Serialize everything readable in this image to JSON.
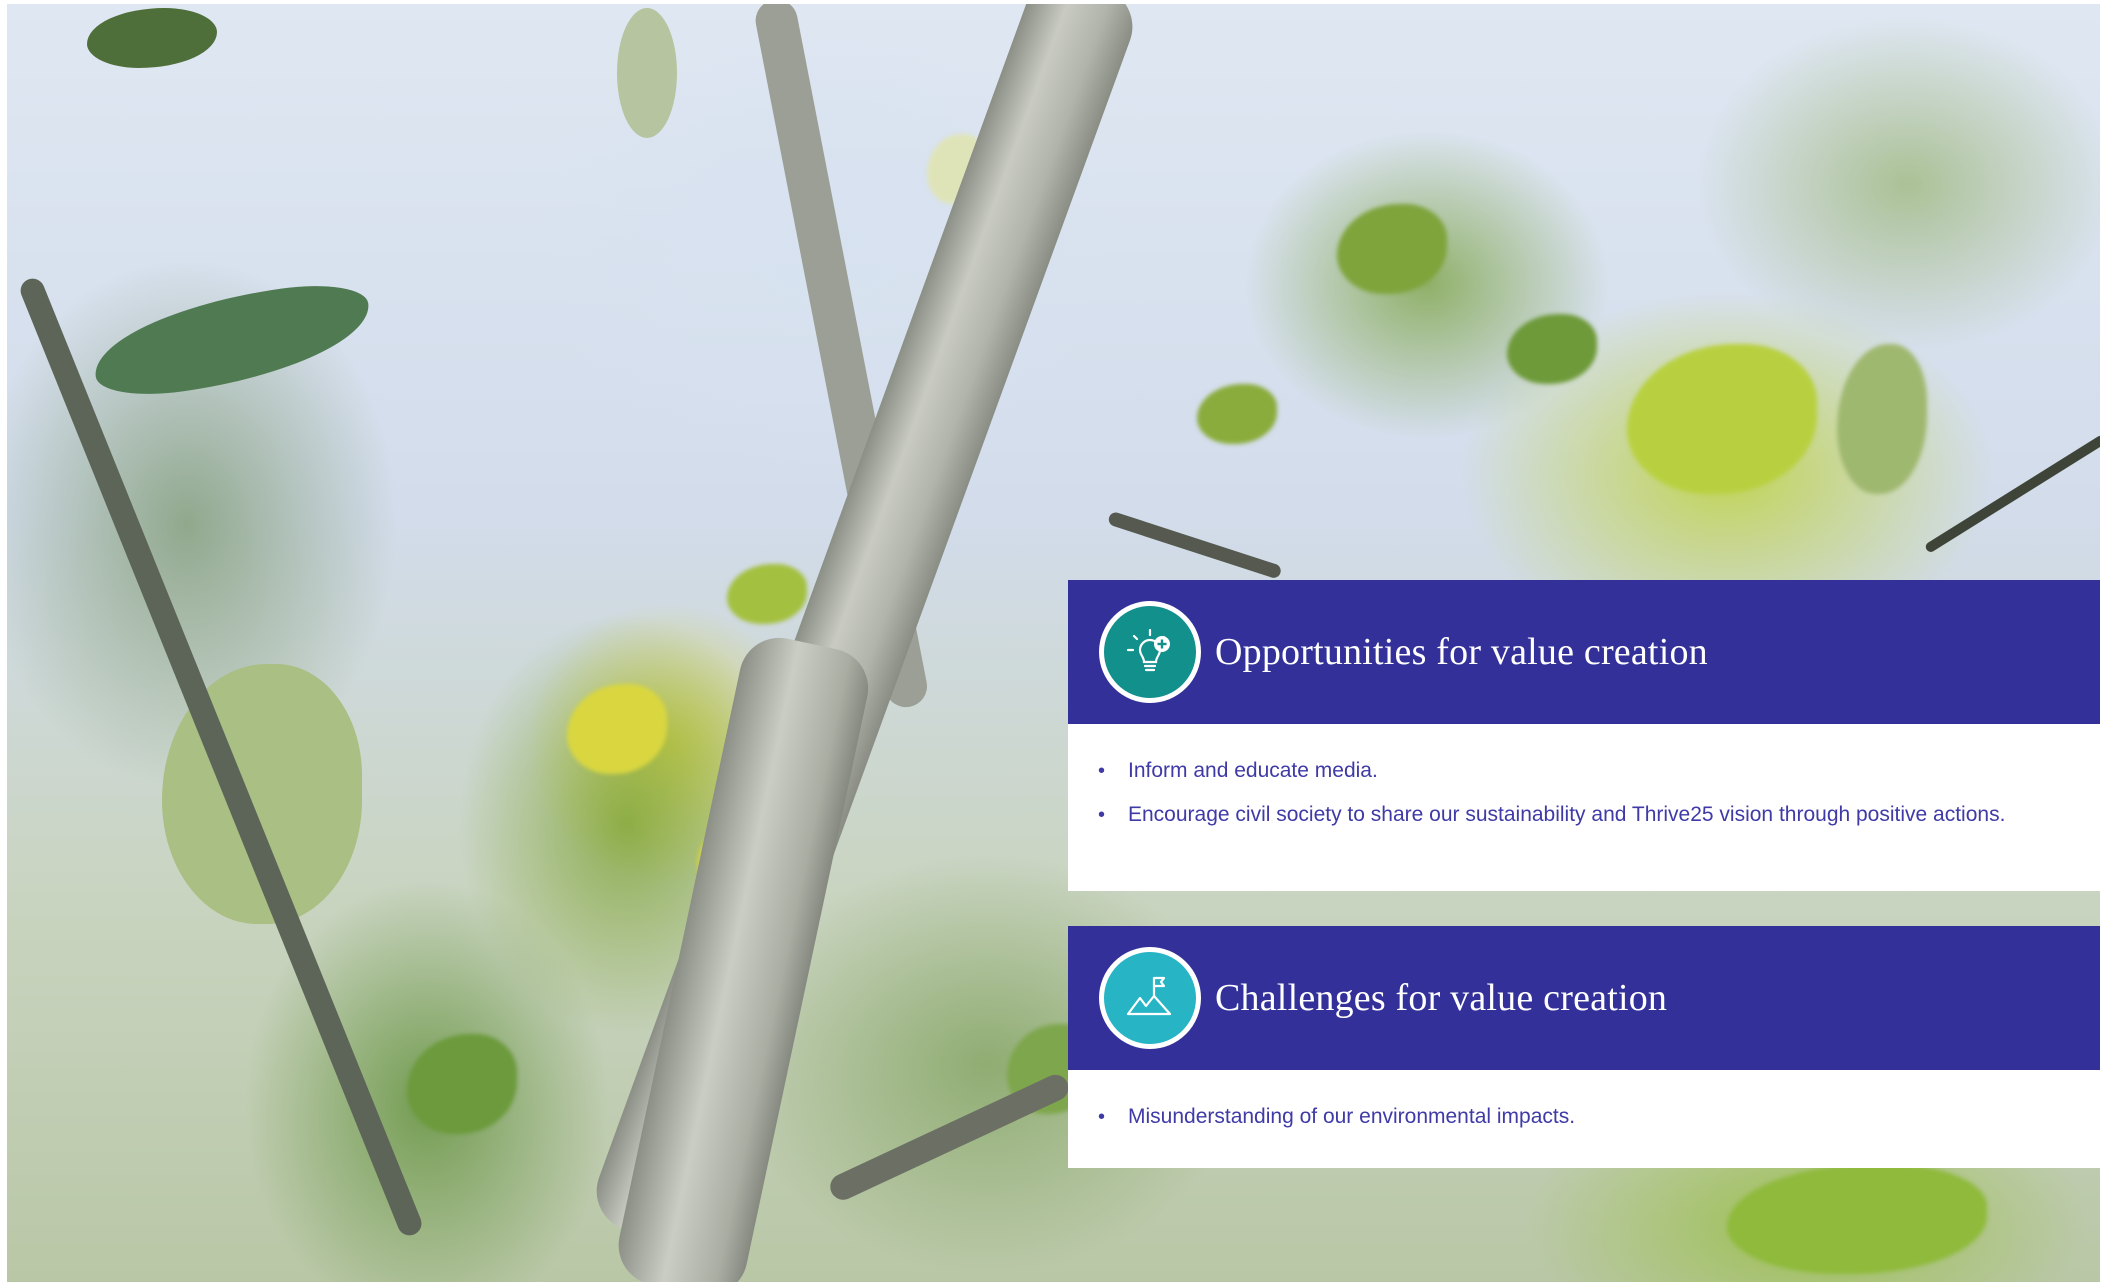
{
  "opportunities": {
    "icon": "lightbulb-plus-icon",
    "icon_color": "#12908c",
    "title": "Opportunities for value creation",
    "items": [
      "Inform and educate media.",
      "Encourage civil society to share our sustainability and Thrive25 vision through positive actions."
    ]
  },
  "challenges": {
    "icon": "mountain-flag-icon",
    "icon_color": "#27b4c5",
    "title": "Challenges for value creation",
    "items": [
      "Misunderstanding of our environmental impacts."
    ]
  },
  "colors": {
    "panel_header": "#33309a",
    "bullet_text": "#3f3aa6"
  }
}
